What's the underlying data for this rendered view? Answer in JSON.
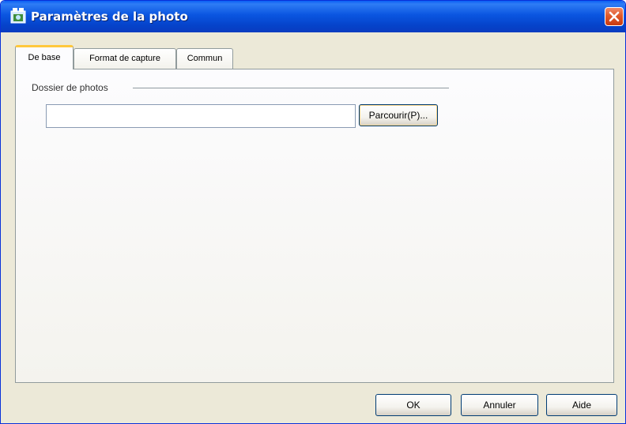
{
  "window": {
    "title": "Paramètres de la photo"
  },
  "tabs": [
    {
      "label": "De base",
      "active": true
    },
    {
      "label": "Format de capture",
      "active": false
    },
    {
      "label": "Commun",
      "active": false
    }
  ],
  "panel": {
    "group_label": "Dossier de photos",
    "path_value": "",
    "browse_label": "Parcourir(P)..."
  },
  "footer": {
    "ok_label": "OK",
    "cancel_label": "Annuler",
    "help_label": "Aide"
  },
  "icons": {
    "app": "photo-settings-icon",
    "close": "close-icon"
  },
  "colors": {
    "titlebar": "#0a55e0",
    "close_button": "#e05a2a",
    "active_tab_accent": "#ffc83c",
    "window_bg": "#ece9d8"
  }
}
